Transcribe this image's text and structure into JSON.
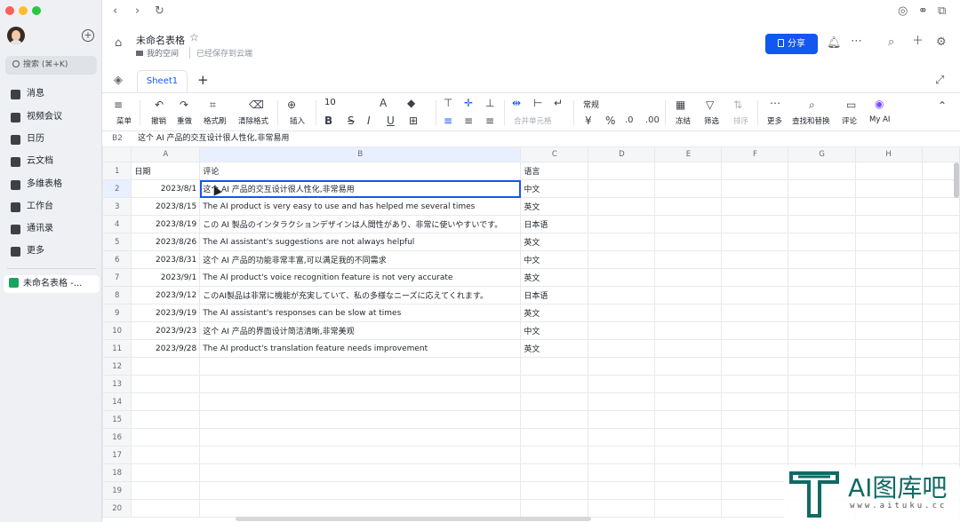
{
  "sidebar": {
    "search_placeholder": "搜索 (⌘+K)",
    "items": [
      {
        "label": "消息",
        "icon": "message-icon"
      },
      {
        "label": "视频会议",
        "icon": "video-icon"
      },
      {
        "label": "日历",
        "icon": "calendar-icon"
      },
      {
        "label": "云文档",
        "icon": "docs-icon"
      },
      {
        "label": "多维表格",
        "icon": "base-icon"
      },
      {
        "label": "工作台",
        "icon": "workplace-icon"
      },
      {
        "label": "通讯录",
        "icon": "contacts-icon"
      },
      {
        "label": "更多",
        "icon": "more-icon"
      }
    ],
    "current_doc": "未命名表格 -..."
  },
  "doc": {
    "title": "未命名表格",
    "location": "我的空间",
    "saved": "已经保存到云端",
    "share": "分享"
  },
  "tabs": {
    "sheet1": "Sheet1"
  },
  "toolbar": {
    "menu": "菜单",
    "undo": "撤销",
    "redo": "重做",
    "format_painter": "格式刷",
    "clear_format": "清除格式",
    "insert": "插入",
    "font_size": "10",
    "merge": "合并单元格",
    "number_format": "常规",
    "freeze": "冻结",
    "filter": "筛选",
    "sort": "排序",
    "more": "更多",
    "find_replace": "查找和替换",
    "comment": "评论",
    "my_ai": "My AI"
  },
  "formula": {
    "cell": "B2",
    "value": "这个 AI 产品的交互设计很人性化,非常易用"
  },
  "columns": [
    "A",
    "B",
    "C",
    "D",
    "E",
    "F",
    "G",
    "H"
  ],
  "rows": [
    [
      "日期",
      "评论",
      "语言"
    ],
    [
      "2023/8/1",
      "这个 AI 产品的交互设计很人性化,非常易用",
      "中文"
    ],
    [
      "2023/8/15",
      "The AI product is very easy to use and has helped me several times",
      "英文"
    ],
    [
      "2023/8/19",
      "この AI 製品のインタラクションデザインは人間性があり、非常に使いやすいです。",
      "日本语"
    ],
    [
      "2023/8/26",
      "The AI assistant's suggestions are not always helpful",
      "英文"
    ],
    [
      "2023/8/31",
      "这个 AI 产品的功能非常丰富,可以满足我的不同需求",
      "中文"
    ],
    [
      "2023/9/1",
      "The AI product's voice recognition feature is not very accurate",
      "英文"
    ],
    [
      "2023/9/12",
      "このAI製品は非常に機能が充実していて、私の多様なニーズに応えてくれます。",
      "日本语"
    ],
    [
      "2023/9/19",
      "The AI assistant's responses can be slow at times",
      "英文"
    ],
    [
      "2023/9/23",
      "这个 AI 产品的界面设计简洁清晰,非常美观",
      "中文"
    ],
    [
      "2023/9/28",
      "The AI product's translation feature needs improvement",
      "英文"
    ]
  ],
  "total_rows": 20,
  "watermark": {
    "name": "AI图库吧",
    "url": "www.aituku.cc"
  }
}
